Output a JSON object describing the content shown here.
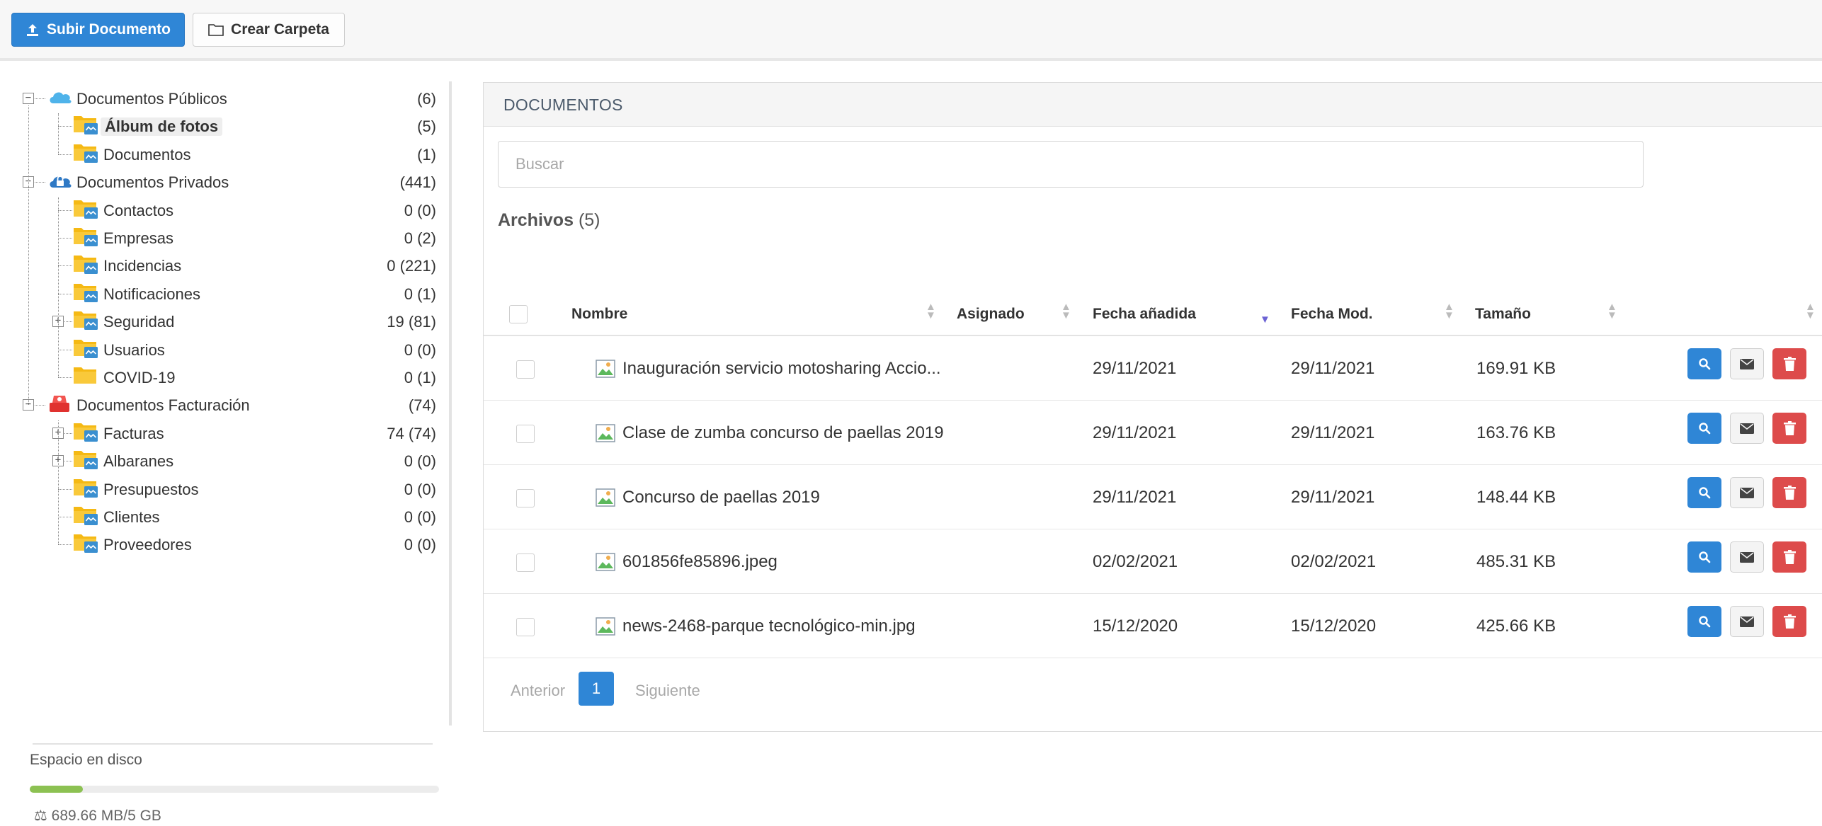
{
  "toolbar": {
    "upload_label": "Subir Documento",
    "create_folder_label": "Crear Carpeta"
  },
  "tree": [
    {
      "label": "Documentos Públicos",
      "count": "(6)",
      "icon": "cloud-icon",
      "level": 0,
      "expander": "−"
    },
    {
      "label": "Álbum de fotos",
      "count": "(5)",
      "icon": "folder-icon",
      "level": 1,
      "selected": true
    },
    {
      "label": "Documentos",
      "count": "(1)",
      "icon": "folder-icon",
      "level": 1
    },
    {
      "label": "Documentos Privados",
      "count": "(441)",
      "icon": "private-cloud-icon",
      "level": 0,
      "expander": "−"
    },
    {
      "label": "Contactos",
      "count": "0 (0)",
      "icon": "folder-icon",
      "level": 1
    },
    {
      "label": "Empresas",
      "count": "0 (2)",
      "icon": "folder-icon",
      "level": 1
    },
    {
      "label": "Incidencias",
      "count": "0 (221)",
      "icon": "folder-icon",
      "level": 1
    },
    {
      "label": "Notificaciones",
      "count": "0 (1)",
      "icon": "folder-icon",
      "level": 1
    },
    {
      "label": "Seguridad",
      "count": "19 (81)",
      "icon": "folder-icon",
      "level": 1,
      "expander": "+"
    },
    {
      "label": "Usuarios",
      "count": "0 (0)",
      "icon": "folder-icon",
      "level": 1
    },
    {
      "label": "COVID-19",
      "count": "0 (1)",
      "icon": "plain-folder-icon",
      "level": 1
    },
    {
      "label": "Documentos Facturación",
      "count": "(74)",
      "icon": "billing-icon",
      "level": 0,
      "expander": "−"
    },
    {
      "label": "Facturas",
      "count": "74 (74)",
      "icon": "folder-icon",
      "level": 1,
      "expander": "+"
    },
    {
      "label": "Albaranes",
      "count": "0 (0)",
      "icon": "folder-icon",
      "level": 1,
      "expander": "+"
    },
    {
      "label": "Presupuestos",
      "count": "0 (0)",
      "icon": "folder-icon",
      "level": 1
    },
    {
      "label": "Clientes",
      "count": "0 (0)",
      "icon": "folder-icon",
      "level": 1
    },
    {
      "label": "Proveedores",
      "count": "0 (0)",
      "icon": "folder-icon",
      "level": 1
    }
  ],
  "disk": {
    "title": "Espacio en disco",
    "usage": "689.66 MB/5 GB",
    "used_percent": 13
  },
  "panel": {
    "title": "DOCUMENTOS",
    "search_placeholder": "Buscar",
    "files_label": "Archivos",
    "files_count": "(5)"
  },
  "table": {
    "headers": {
      "name": "Nombre",
      "assigned": "Asignado",
      "added": "Fecha añadida",
      "modified": "Fecha Mod.",
      "size": "Tamaño"
    },
    "rows": [
      {
        "name": "Inauguración servicio motosharing Accio...",
        "added": "29/11/2021",
        "modified": "29/11/2021",
        "size": "169.91 KB"
      },
      {
        "name": "Clase de zumba concurso de paellas 2019",
        "added": "29/11/2021",
        "modified": "29/11/2021",
        "size": "163.76 KB"
      },
      {
        "name": "Concurso de paellas 2019",
        "added": "29/11/2021",
        "modified": "29/11/2021",
        "size": "148.44 KB"
      },
      {
        "name": "601856fe85896.jpeg",
        "added": "02/02/2021",
        "modified": "02/02/2021",
        "size": "485.31 KB"
      },
      {
        "name": "news-2468-parque tecnológico-min.jpg",
        "added": "15/12/2020",
        "modified": "15/12/2020",
        "size": "425.66 KB"
      }
    ]
  },
  "pagination": {
    "prev": "Anterior",
    "current": "1",
    "next": "Siguiente"
  },
  "colors": {
    "primary": "#2f86d6",
    "danger": "#dd4b4b",
    "folder": "#f5b914",
    "disk_fill": "#8cc152"
  }
}
